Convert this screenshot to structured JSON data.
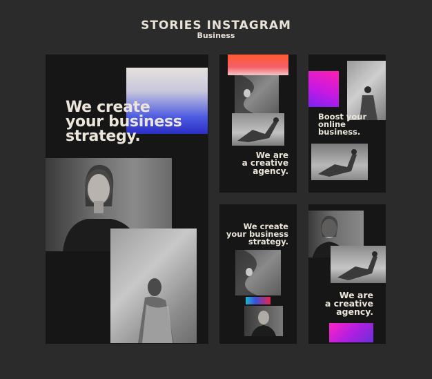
{
  "header": {
    "title": "STORIES INSTAGRAM",
    "subtitle": "Business"
  },
  "stories": {
    "main": {
      "headline_lines": [
        "We create",
        "your business",
        "strategy."
      ]
    },
    "story2": {
      "text_lines": [
        "We are",
        "a creative",
        "agency."
      ]
    },
    "story3": {
      "text_lines": [
        "Boost your",
        "online",
        "business."
      ]
    },
    "story4": {
      "text_lines": [
        "We create",
        "your business",
        "strategy."
      ]
    },
    "story5": {
      "text_lines": [
        "We are",
        "a creative",
        "agency."
      ]
    }
  },
  "colors": {
    "background": "#2b2b2b",
    "card": "#161616",
    "text": "#ece6da",
    "blue_gradient": "#2b3fd6",
    "red_gradient": "#f0442e",
    "magenta_gradient": "#d81ed6",
    "purple_gradient": "#8a2be2"
  }
}
